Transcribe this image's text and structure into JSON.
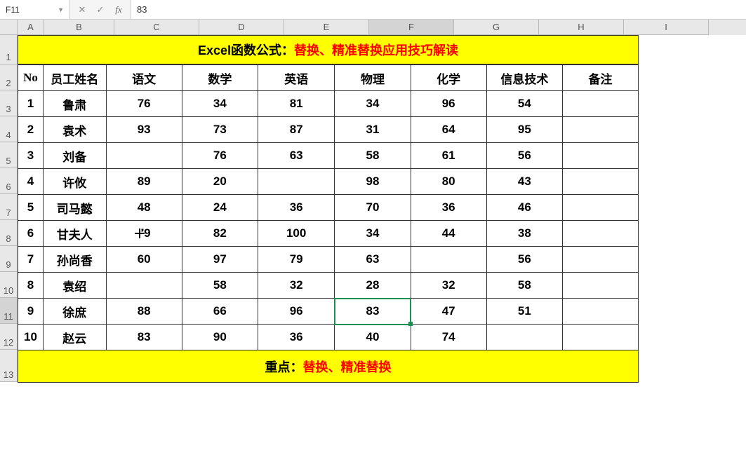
{
  "formula_bar": {
    "cell_ref": "F11",
    "formula_value": "83"
  },
  "columns": [
    "A",
    "B",
    "C",
    "D",
    "E",
    "F",
    "G",
    "H",
    "I"
  ],
  "rows": [
    "1",
    "2",
    "3",
    "4",
    "5",
    "6",
    "7",
    "8",
    "9",
    "10",
    "11",
    "12",
    "13"
  ],
  "title": {
    "prefix": "Excel函数公式：",
    "red": "替换、精准替换应用技巧解读"
  },
  "headers": [
    "No",
    "员工姓名",
    "语文",
    "数学",
    "英语",
    "物理",
    "化学",
    "信息技术",
    "备注"
  ],
  "data_rows": [
    {
      "no": "1",
      "name": "鲁肃",
      "c": "76",
      "d": "34",
      "e": "81",
      "f": "34",
      "g": "96",
      "h": "54",
      "i": ""
    },
    {
      "no": "2",
      "name": "袁术",
      "c": "93",
      "d": "73",
      "e": "87",
      "f": "31",
      "g": "64",
      "h": "95",
      "i": ""
    },
    {
      "no": "3",
      "name": "刘备",
      "c": "",
      "d": "76",
      "e": "63",
      "f": "58",
      "g": "61",
      "h": "56",
      "i": ""
    },
    {
      "no": "4",
      "name": "许攸",
      "c": "89",
      "d": "20",
      "e": "",
      "f": "98",
      "g": "80",
      "h": "43",
      "i": ""
    },
    {
      "no": "5",
      "name": "司马懿",
      "c": "48",
      "d": "24",
      "e": "36",
      "f": "70",
      "g": "36",
      "h": "46",
      "i": ""
    },
    {
      "no": "6",
      "name": "甘夫人",
      "c": "79",
      "d": "82",
      "e": "100",
      "f": "34",
      "g": "44",
      "h": "38",
      "i": ""
    },
    {
      "no": "7",
      "name": "孙尚香",
      "c": "60",
      "d": "97",
      "e": "79",
      "f": "63",
      "g": "",
      "h": "56",
      "i": ""
    },
    {
      "no": "8",
      "name": "袁绍",
      "c": "",
      "d": "58",
      "e": "32",
      "f": "28",
      "g": "32",
      "h": "58",
      "i": ""
    },
    {
      "no": "9",
      "name": "徐庶",
      "c": "88",
      "d": "66",
      "e": "96",
      "f": "83",
      "g": "47",
      "h": "51",
      "i": ""
    },
    {
      "no": "10",
      "name": "赵云",
      "c": "83",
      "d": "90",
      "e": "36",
      "f": "40",
      "g": "74",
      "h": "",
      "i": ""
    }
  ],
  "footer": {
    "prefix": "重点：",
    "red": "替换、精准替换"
  },
  "active_cell": {
    "row": 11,
    "col": "F"
  },
  "chart_data": {
    "type": "table",
    "title": "Excel函数公式：替换、精准替换应用技巧解读",
    "columns": [
      "No",
      "员工姓名",
      "语文",
      "数学",
      "英语",
      "物理",
      "化学",
      "信息技术",
      "备注"
    ],
    "rows": [
      [
        1,
        "鲁肃",
        76,
        34,
        81,
        34,
        96,
        54,
        null
      ],
      [
        2,
        "袁术",
        93,
        73,
        87,
        31,
        64,
        95,
        null
      ],
      [
        3,
        "刘备",
        null,
        76,
        63,
        58,
        61,
        56,
        null
      ],
      [
        4,
        "许攸",
        89,
        20,
        null,
        98,
        80,
        43,
        null
      ],
      [
        5,
        "司马懿",
        48,
        24,
        36,
        70,
        36,
        46,
        null
      ],
      [
        6,
        "甘夫人",
        79,
        82,
        100,
        34,
        44,
        38,
        null
      ],
      [
        7,
        "孙尚香",
        60,
        97,
        79,
        63,
        null,
        56,
        null
      ],
      [
        8,
        "袁绍",
        null,
        58,
        32,
        28,
        32,
        58,
        null
      ],
      [
        9,
        "徐庶",
        88,
        66,
        96,
        83,
        47,
        51,
        null
      ],
      [
        10,
        "赵云",
        83,
        90,
        36,
        40,
        74,
        null,
        null
      ]
    ],
    "footer": "重点：替换、精准替换"
  }
}
